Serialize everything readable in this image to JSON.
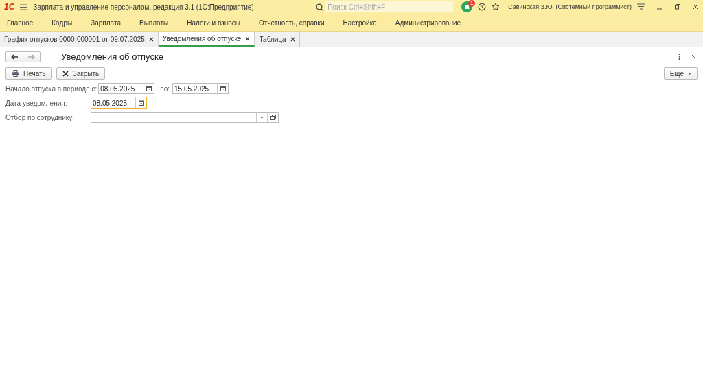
{
  "titlebar": {
    "logo": "1С",
    "title": "Зарплата и управление персоналом, редакция 3.1  (1С:Предприятие)",
    "search": {
      "placeholder": "Поиск Ctrl+Shift+F"
    },
    "notification_count": "1",
    "user": "Савинская З.Ю. (Системный программист)"
  },
  "menu": [
    "Главное",
    "Кадры",
    "Зарплата",
    "Выплаты",
    "Налоги и взносы",
    "Отчетность, справки",
    "Настройка",
    "Администрирование"
  ],
  "tabs": [
    {
      "label": "График отпусков 0000-000001 от 09.07.2025",
      "selected": false
    },
    {
      "label": "Уведомления об отпуске",
      "selected": true
    },
    {
      "label": "Таблица",
      "selected": false
    }
  ],
  "form": {
    "title": "Уведомления об отпуске",
    "buttons": [
      {
        "kind": "print",
        "label": "Печать"
      },
      {
        "kind": "close",
        "label": "Закрыть"
      }
    ],
    "more_button": "Еще",
    "fields": [
      {
        "kind": "date",
        "label": "Начало отпуска в периоде с:",
        "value": "08.05.2025",
        "focused": false,
        "to_label": "по:",
        "to_value": "15.05.2025"
      },
      {
        "kind": "date",
        "label": "Дата уведомления:",
        "value": "08.05.2025",
        "focused": true
      },
      {
        "kind": "select",
        "label": "Отбор по сотруднику:",
        "focused": false
      }
    ]
  }
}
